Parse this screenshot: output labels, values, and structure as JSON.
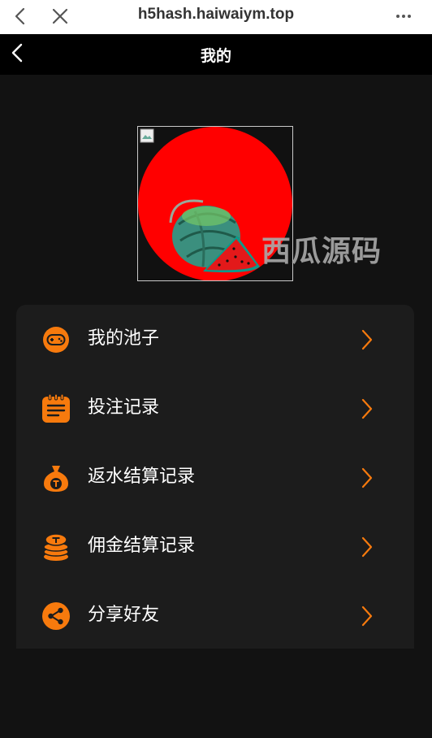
{
  "browser": {
    "url": "h5hash.haiwaiym.top"
  },
  "header": {
    "title": "我的"
  },
  "watermark": "西瓜源码",
  "menu": {
    "items": [
      {
        "label": "我的池子",
        "icon": "gamepad-icon"
      },
      {
        "label": "投注记录",
        "icon": "notepad-icon"
      },
      {
        "label": "返水结算记录",
        "icon": "money-bag-icon"
      },
      {
        "label": "佣金结算记录",
        "icon": "coin-stack-icon"
      },
      {
        "label": "分享好友",
        "icon": "share-icon"
      }
    ]
  },
  "colors": {
    "accent": "#f77a0d",
    "background": "#121212",
    "card": "#1c1c1c",
    "avatar_red": "#ff0000"
  }
}
